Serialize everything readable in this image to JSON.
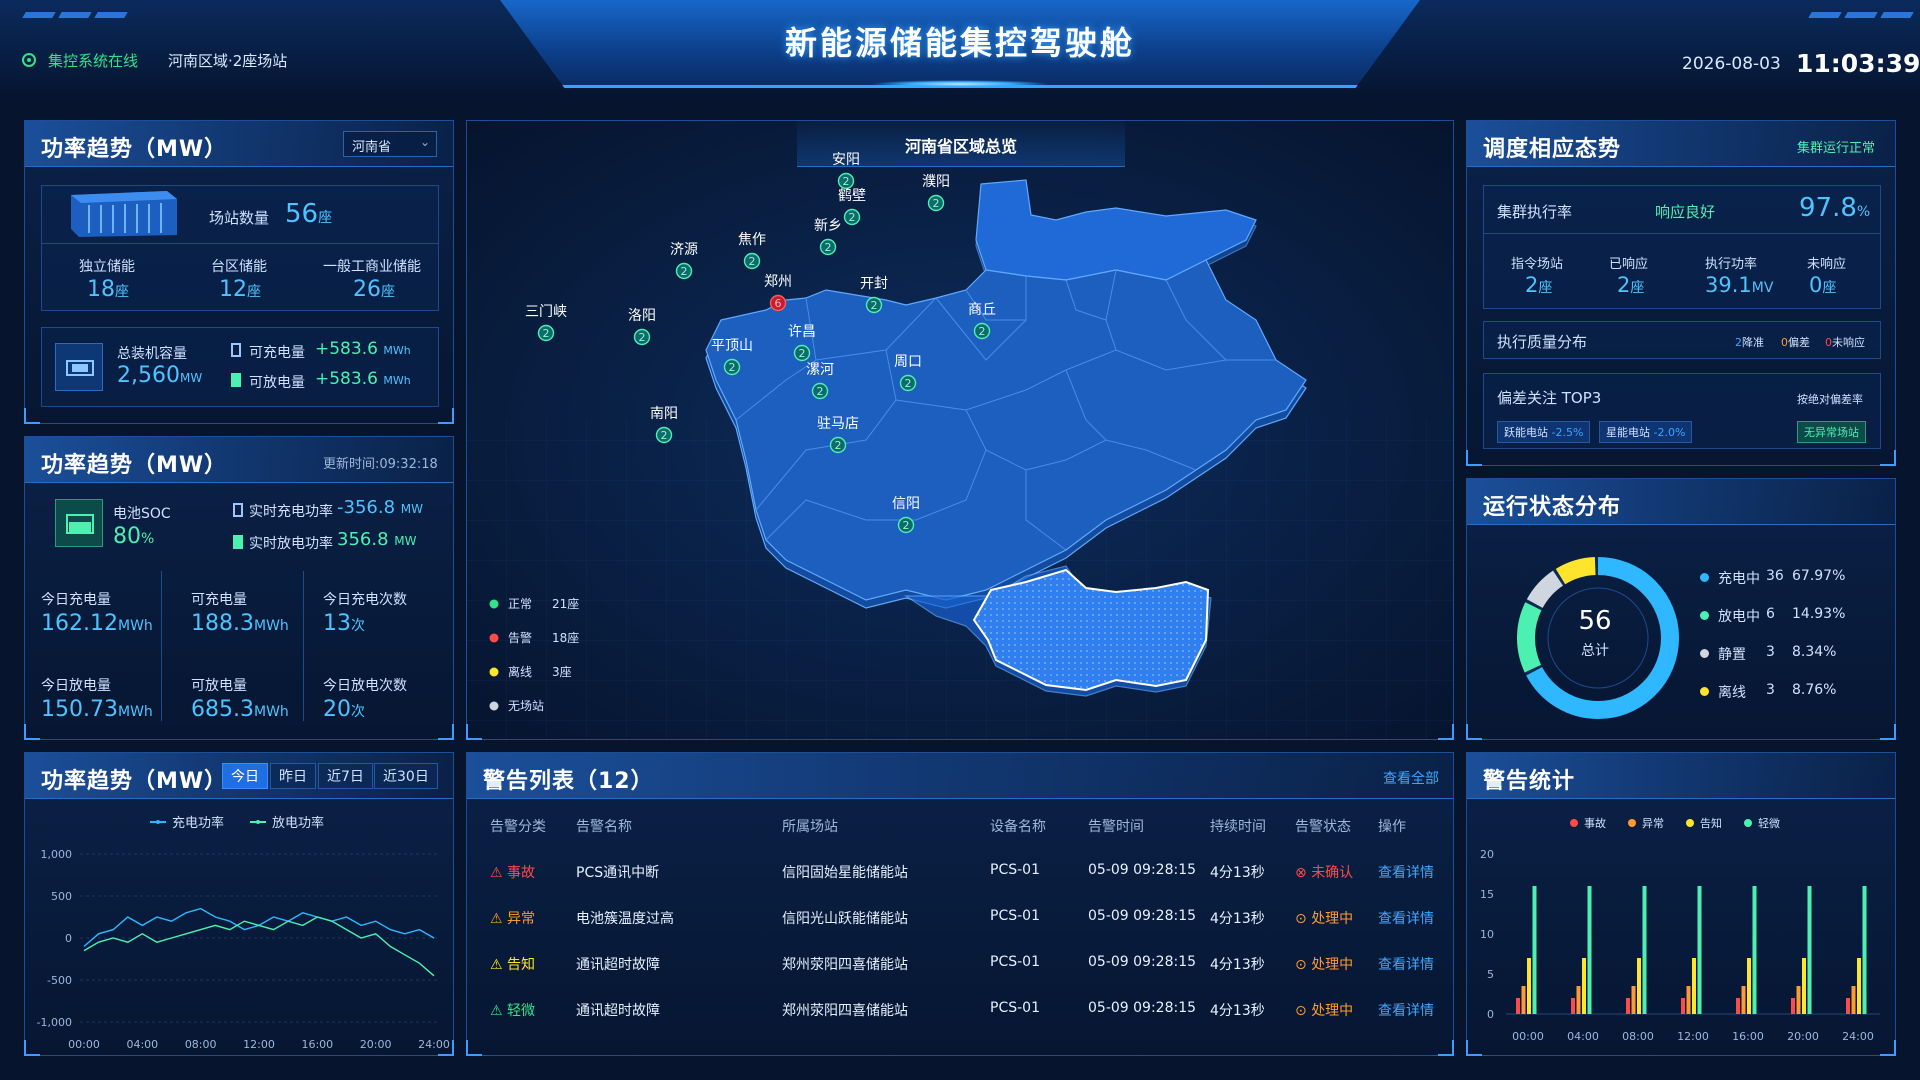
{
  "header": {
    "title": "新能源储能集控驾驶舱",
    "status": "集控系统在线",
    "location": "河南区域·2座场站",
    "date": "2026-08-03",
    "time": "11:03:39"
  },
  "power_panel": {
    "title": "功率趋势（MW）",
    "province_select": "河南省",
    "station_count_label": "场站数量",
    "station_count": "56",
    "station_unit": "座",
    "types": [
      {
        "label": "独立储能",
        "value": "18",
        "unit": "座"
      },
      {
        "label": "台区储能",
        "value": "12",
        "unit": "座"
      },
      {
        "label": "一般工商业储能",
        "value": "26",
        "unit": "座"
      }
    ],
    "capacity_label": "总装机容量",
    "capacity_value": "2,560",
    "capacity_unit": "MW",
    "chargeable_label": "可充电量",
    "chargeable_value": "+583.6",
    "dischargeable_label": "可放电量",
    "dischargeable_value": "+583.6",
    "energy_unit": "MWh"
  },
  "soc_panel": {
    "title": "功率趋势（MW）",
    "update_time": "更新时间:09:32:18",
    "soc_label": "电池SOC",
    "soc_value": "80",
    "soc_unit": "%",
    "rt_charge_label": "实时充电功率",
    "rt_charge_value": "-356.8",
    "rt_discharge_label": "实时放电功率",
    "rt_discharge_value": "356.8",
    "power_unit": "MW",
    "stats": [
      {
        "label": "今日充电量",
        "value": "162.12",
        "unit": "MWh"
      },
      {
        "label": "可充电量",
        "value": "188.3",
        "unit": "MWh"
      },
      {
        "label": "今日充电次数",
        "value": "13",
        "unit": "次"
      },
      {
        "label": "今日放电量",
        "value": "150.73",
        "unit": "MWh"
      },
      {
        "label": "可放电量",
        "value": "685.3",
        "unit": "MWh"
      },
      {
        "label": "今日放电次数",
        "value": "20",
        "unit": "次"
      }
    ]
  },
  "trend_panel": {
    "title": "功率趋势（MW）",
    "tabs": [
      "今日",
      "昨日",
      "近7日",
      "近30日"
    ],
    "active_tab": "今日",
    "legend_charge": "充电功率",
    "legend_discharge": "放电功率"
  },
  "map_panel": {
    "title": "河南省区域总览",
    "legend": [
      {
        "label": "正常",
        "value": "21座",
        "color": "#35e08a"
      },
      {
        "label": "告警",
        "value": "18座",
        "color": "#ff4a4a"
      },
      {
        "label": "离线",
        "value": "3座",
        "color": "#ffe42e"
      },
      {
        "label": "无场站",
        "value": "",
        "color": "#cfd6e0"
      }
    ],
    "cities": [
      {
        "name": "安阳",
        "count": "2"
      },
      {
        "name": "濮阳",
        "count": "2"
      },
      {
        "name": "鹤壁",
        "count": "2"
      },
      {
        "name": "新乡",
        "count": "2"
      },
      {
        "name": "焦作",
        "count": "2"
      },
      {
        "name": "济源",
        "count": "2"
      },
      {
        "name": "郑州",
        "count": "6"
      },
      {
        "name": "开封",
        "count": "2"
      },
      {
        "name": "三门峡",
        "count": "2"
      },
      {
        "name": "洛阳",
        "count": "2"
      },
      {
        "name": "商丘",
        "count": "2"
      },
      {
        "name": "许昌",
        "count": "2"
      },
      {
        "name": "平顶山",
        "count": "2"
      },
      {
        "name": "漯河",
        "count": "2"
      },
      {
        "name": "周口",
        "count": "2"
      },
      {
        "name": "南阳",
        "count": "2"
      },
      {
        "name": "驻马店",
        "count": "2"
      },
      {
        "name": "信阳",
        "count": "2"
      }
    ]
  },
  "alarm_panel": {
    "title": "警告列表（12）",
    "view_all": "查看全部",
    "columns": [
      "告警分类",
      "告警名称",
      "所属场站",
      "设备名称",
      "告警时间",
      "持续时间",
      "告警状态",
      "操作"
    ],
    "rows": [
      {
        "level": "事故",
        "name": "PCS通讯中断",
        "station": "信阳固始星能储能站",
        "device": "PCS-01",
        "time": "05-09 09:28:15",
        "duration": "4分13秒",
        "status": "未确认",
        "action": "查看详情"
      },
      {
        "level": "异常",
        "name": "电池簇温度过高",
        "station": "信阳光山跃能储能站",
        "device": "PCS-01",
        "time": "05-09 09:28:15",
        "duration": "4分13秒",
        "status": "处理中",
        "action": "查看详情"
      },
      {
        "level": "告知",
        "name": "通讯超时故障",
        "station": "郑州荥阳四喜储能站",
        "device": "PCS-01",
        "time": "05-09 09:28:15",
        "duration": "4分13秒",
        "status": "处理中",
        "action": "查看详情"
      },
      {
        "level": "轻微",
        "name": "通讯超时故障",
        "station": "郑州荥阳四喜储能站",
        "device": "PCS-01",
        "time": "05-09 09:28:15",
        "duration": "4分13秒",
        "status": "处理中",
        "action": "查看详情"
      }
    ],
    "level_colors": {
      "事故": "#ff4a4a",
      "异常": "#ff9a2e",
      "告知": "#ffe42e",
      "轻微": "#35e08a"
    }
  },
  "dispatch_panel": {
    "title": "调度相应态势",
    "cluster_status": "集群运行正常",
    "exec_rate_label": "集群执行率",
    "response_label": "响应良好",
    "exec_rate_value": "97.8",
    "exec_rate_unit": "%",
    "metrics": [
      {
        "label": "指令场站",
        "value": "2",
        "unit": "座"
      },
      {
        "label": "已响应",
        "value": "2",
        "unit": "座"
      },
      {
        "label": "执行功率",
        "value": "39.1",
        "unit": "MV"
      },
      {
        "label": "未响应",
        "value": "0",
        "unit": "座"
      }
    ],
    "quality_label": "执行质量分布",
    "quality_items": [
      {
        "value": "2",
        "label": "降准"
      },
      {
        "value": "0",
        "label": "偏差"
      },
      {
        "value": "0",
        "label": "未响应"
      }
    ],
    "deviation_label": "偏差关注 TOP3",
    "deviation_sort": "按绝对偏差率",
    "deviation_tags": [
      {
        "name": "跃能电站",
        "value": "-2.5%"
      },
      {
        "name": "星能电站",
        "value": "-2.0%"
      }
    ],
    "no_anomaly": "无异常场站"
  },
  "status_panel": {
    "title": "运行状态分布",
    "total": "56",
    "total_label": "总计",
    "items": [
      {
        "label": "充电中",
        "count": "36",
        "percent": "67.97%",
        "color": "#2fb8ff",
        "share": 0.6797
      },
      {
        "label": "放电中",
        "count": "6",
        "percent": "14.93%",
        "color": "#4cf0b0",
        "share": 0.1493
      },
      {
        "label": "静置",
        "count": "3",
        "percent": "8.34%",
        "color": "#cfd6e0",
        "share": 0.0834
      },
      {
        "label": "离线",
        "count": "3",
        "percent": "8.76%",
        "color": "#ffe42e",
        "share": 0.0876
      }
    ]
  },
  "alarm_stats_panel": {
    "title": "警告统计",
    "legend": [
      "事故",
      "异常",
      "告知",
      "轻微"
    ]
  },
  "chart_data": [
    {
      "type": "line",
      "x": [
        "00:00",
        "04:00",
        "08:00",
        "12:00",
        "16:00",
        "20:00",
        "24:00"
      ],
      "ylim": [
        -1000,
        1000
      ],
      "yticks": [
        1000,
        500,
        0,
        -500,
        -1000
      ],
      "series": [
        {
          "name": "充电功率",
          "color": "#2fb8ff",
          "values": [
            -100,
            50,
            100,
            250,
            150,
            250,
            200,
            300,
            350,
            250,
            200,
            100,
            150,
            250,
            200,
            300,
            250,
            200,
            250,
            150,
            200,
            100,
            50,
            100,
            0
          ]
        },
        {
          "name": "放电功率",
          "color": "#4cf0b0",
          "values": [
            -150,
            -50,
            0,
            -50,
            50,
            -50,
            0,
            50,
            100,
            150,
            100,
            200,
            150,
            100,
            200,
            150,
            250,
            200,
            100,
            0,
            50,
            -100,
            -200,
            -300,
            -450
          ]
        }
      ]
    },
    {
      "type": "bar",
      "categories": [
        "00:00",
        "04:00",
        "08:00",
        "12:00",
        "16:00",
        "20:00",
        "24:00"
      ],
      "ylim": [
        0,
        20
      ],
      "yticks": [
        20,
        15,
        10,
        5,
        0
      ],
      "series": [
        {
          "name": "事故",
          "color": "#ff4a4a",
          "values": [
            2,
            2,
            2,
            2,
            2,
            2,
            2
          ]
        },
        {
          "name": "异常",
          "color": "#ff9a2e",
          "values": [
            3.5,
            3.5,
            3.5,
            3.5,
            3.5,
            3.5,
            3.5
          ]
        },
        {
          "name": "告知",
          "color": "#ffe42e",
          "values": [
            7,
            7,
            7,
            7,
            7,
            7,
            7
          ]
        },
        {
          "name": "轻微",
          "color": "#4cf0b0",
          "values": [
            16,
            16,
            16,
            16,
            16,
            16,
            16
          ]
        }
      ]
    }
  ]
}
